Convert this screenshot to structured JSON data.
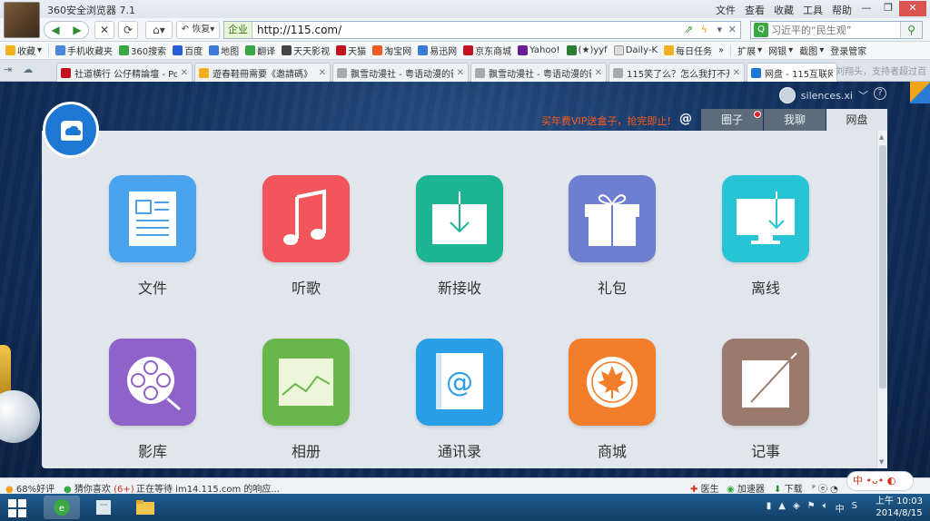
{
  "browser": {
    "title": "360安全浏览器 7.1",
    "menu": [
      "文件",
      "查看",
      "收藏",
      "工具",
      "帮助"
    ],
    "address_zone": "企业",
    "url": "http://115.com/",
    "search_placeholder": "习近平的“民生观”",
    "favorites": [
      {
        "label": "收藏",
        "color": "#f2b01e"
      },
      {
        "label": "手机收藏夹",
        "color": "#4a88d9"
      },
      {
        "label": "360搜索",
        "color": "#3aa745"
      },
      {
        "label": "百度",
        "color": "#2b5fd9"
      },
      {
        "label": "地图",
        "color": "#3a7ad9"
      },
      {
        "label": "翻译",
        "color": "#3aa745"
      },
      {
        "label": "天天影视",
        "color": "#444"
      },
      {
        "label": "天猫",
        "color": "#c3131f"
      },
      {
        "label": "淘宝网",
        "color": "#f05a24"
      },
      {
        "label": "易迅网",
        "color": "#3a7ad9"
      },
      {
        "label": "京东商城",
        "color": "#c3131f"
      },
      {
        "label": "Yahoo!",
        "color": "#6a1b9a"
      },
      {
        "label": "(★)yyf",
        "color": "#2e7d32"
      },
      {
        "label": "Daily-K",
        "color": "#999"
      },
      {
        "label": "每日任务",
        "color": "#f2b01e"
      }
    ],
    "favorites_right": [
      "扩展",
      "网银",
      "截图",
      "登录管家"
    ],
    "tabs": [
      {
        "title": "社道横行 公仔精論壇 - Pov",
        "color": "#c3131f"
      },
      {
        "title": "遊春鞋冊需要《邀請碼》 - 彡",
        "color": "#f2b01e"
      },
      {
        "title": "飘雪动漫社 - 粤语动漫的新",
        "color": "#888"
      },
      {
        "title": "飘雪动漫社 - 粤语动漫的新",
        "color": "#888"
      },
      {
        "title": "115笑了么？怎么我打不开",
        "color": "#888"
      },
      {
        "title": "网盘 - 115互联网",
        "color": "#1e77d4"
      }
    ],
    "tab_ghost": "刘翔头，支持者超过百",
    "status": {
      "rating": "68%好评",
      "guess": "猜你喜欢",
      "guess_count": "(6+)",
      "waiting": "正在等待 im14.115.com 的响应...",
      "doctor": "医生",
      "accelerator": "加速器",
      "download": "下载",
      "ime": "中"
    }
  },
  "page": {
    "username": "silences.xi",
    "promo": "买年费VIP送盒子，抢完即止!",
    "at": "@",
    "tabs": [
      "圈子",
      "我聊",
      "网盘"
    ],
    "apps": [
      {
        "label": "文件",
        "color": "#4aa3ec",
        "icon": "document-icon"
      },
      {
        "label": "听歌",
        "color": "#f2555b",
        "icon": "music-note-icon"
      },
      {
        "label": "新接收",
        "color": "#1db593",
        "icon": "inbox-download-icon"
      },
      {
        "label": "礼包",
        "color": "#6e7fd2",
        "icon": "gift-icon"
      },
      {
        "label": "离线",
        "color": "#27c4d6",
        "icon": "monitor-download-icon"
      },
      {
        "label": "影库",
        "color": "#8e62c9",
        "icon": "film-reel-icon"
      },
      {
        "label": "相册",
        "color": "#69b74c",
        "icon": "photo-chart-icon"
      },
      {
        "label": "通讯录",
        "color": "#2a9ee6",
        "icon": "contacts-at-icon"
      },
      {
        "label": "商城",
        "color": "#f27d2a",
        "icon": "maple-leaf-icon"
      },
      {
        "label": "记事",
        "color": "#9a7a6c",
        "icon": "note-pen-icon"
      }
    ]
  },
  "taskbar": {
    "time": "上午 10:03",
    "date": "2014/8/15"
  }
}
